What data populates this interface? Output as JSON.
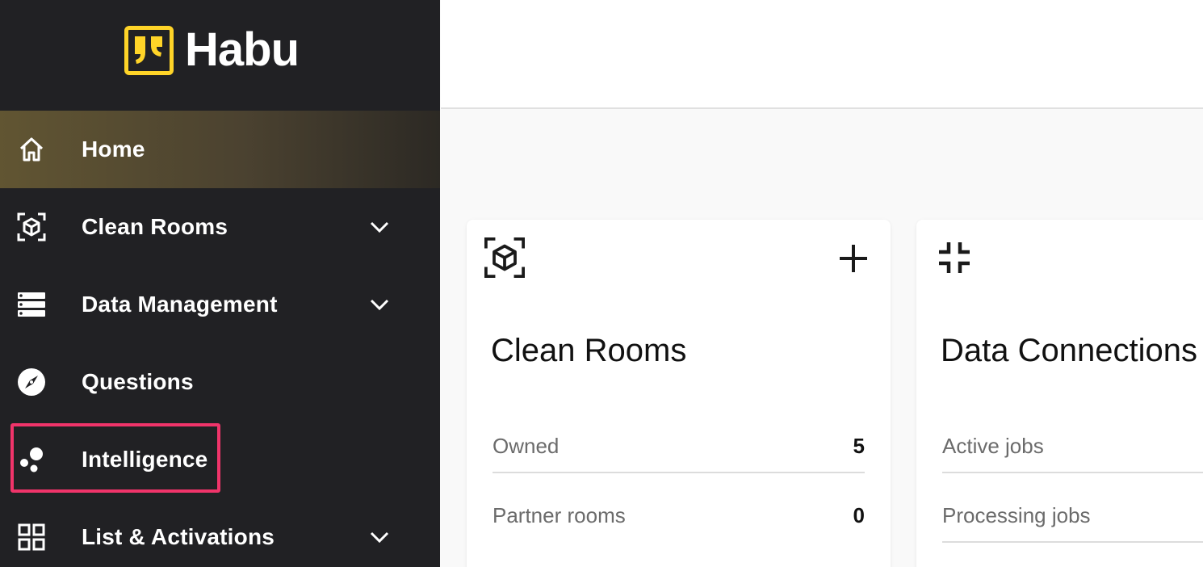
{
  "brand": {
    "name": "Habu",
    "accent": "#FFD428",
    "logo_icon": "habu-quote-logo-icon"
  },
  "sidebar": {
    "items": [
      {
        "label": "Home",
        "icon": "home-icon",
        "active": true,
        "expandable": false
      },
      {
        "label": "Clean Rooms",
        "icon": "cube-scan-icon",
        "active": false,
        "expandable": true
      },
      {
        "label": "Data Management",
        "icon": "database-stack-icon",
        "active": false,
        "expandable": true
      },
      {
        "label": "Questions",
        "icon": "compass-icon",
        "active": false,
        "expandable": false
      },
      {
        "label": "Intelligence",
        "icon": "bubbles-icon",
        "active": false,
        "expandable": false,
        "highlighted": true
      },
      {
        "label": "List & Activations",
        "icon": "grid-icon",
        "active": false,
        "expandable": true
      }
    ],
    "highlight_color": "#F0346A"
  },
  "cards": [
    {
      "title": "Clean Rooms",
      "icon": "cube-scan-icon",
      "action_icon": "plus-icon",
      "rows": [
        {
          "label": "Owned",
          "value": "5"
        },
        {
          "label": "Partner rooms",
          "value": "0"
        }
      ]
    },
    {
      "title": "Data Connections",
      "icon": "compress-icon",
      "rows": [
        {
          "label": "Active jobs",
          "value": ""
        },
        {
          "label": "Processing jobs",
          "value": ""
        }
      ]
    }
  ]
}
